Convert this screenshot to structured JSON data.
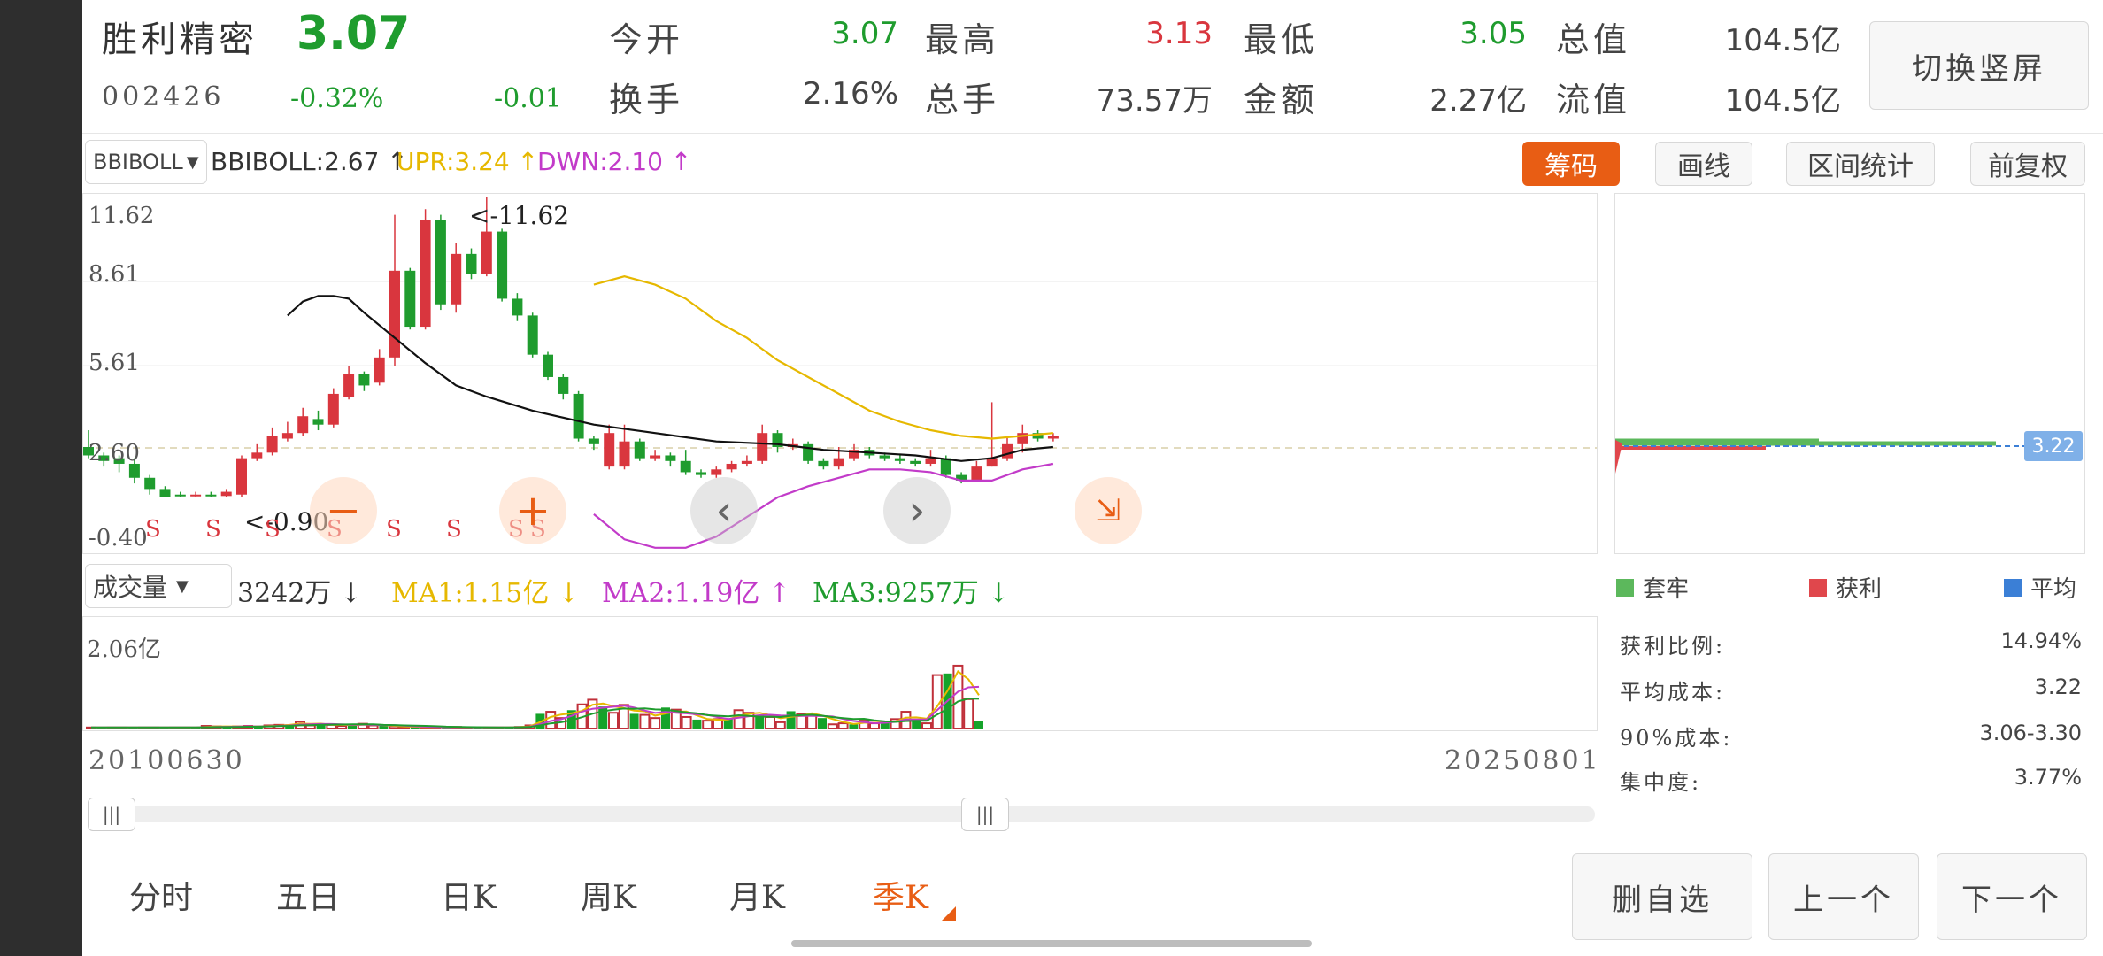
{
  "stock": {
    "name": "胜利精密",
    "price": "3.07",
    "code": "002426",
    "change_pct": "-0.32%",
    "change": "-0.01"
  },
  "quote": [
    {
      "label": "今开",
      "value": "3.07",
      "color": "#1f9c2e"
    },
    {
      "label": "最高",
      "value": "3.13",
      "color": "#d9363e"
    },
    {
      "label": "最低",
      "value": "3.05",
      "color": "#1f9c2e"
    },
    {
      "label": "总值",
      "value": "104.5亿",
      "color": "#444444"
    },
    {
      "label": "换手",
      "value": "2.16%",
      "color": "#444444"
    },
    {
      "label": "总手",
      "value": "73.57万",
      "color": "#444444"
    },
    {
      "label": "金额",
      "value": "2.27亿",
      "color": "#444444"
    },
    {
      "label": "流值",
      "value": "104.5亿",
      "color": "#444444"
    }
  ],
  "switch_button": "切换竖屏",
  "indicator": {
    "selector": "BBIBOLL",
    "bbiboll": "BBIBOLL:2.67 ↑",
    "upr": "UPR:3.24 ↑",
    "dwn": "DWN:2.10 ↑"
  },
  "tool_buttons": {
    "chips": "筹码",
    "draw": "画线",
    "range_stats": "区间统计",
    "adjust": "前复权"
  },
  "price_axis": [
    "11.62",
    "8.61",
    "5.61",
    "2.60",
    "-0.40"
  ],
  "annotations": {
    "high": "<-11.62",
    "low": "<-0.90",
    "signal": "S"
  },
  "volume": {
    "selector": "成交量",
    "vol": "3242万 ↓",
    "ma1": "MA1:1.15亿 ↓",
    "ma2": "MA2:1.19亿 ↑",
    "ma3": "MA3:9257万 ↓",
    "axis_max": "2.06亿"
  },
  "date_range": {
    "start": "20100630",
    "end": "20250801"
  },
  "chip_price_tag": "3.22",
  "chip_legend": [
    {
      "label": "套牢",
      "color": "#5cb85c"
    },
    {
      "label": "获利",
      "color": "#e0474c"
    },
    {
      "label": "平均",
      "color": "#3b7fd6"
    }
  ],
  "chip_stats": [
    {
      "label": "获利比例:",
      "value": "14.94%"
    },
    {
      "label": "平均成本:",
      "value": "3.22"
    },
    {
      "label": "90%成本:",
      "value": "3.06-3.30"
    },
    {
      "label": "集中度:",
      "value": "3.77%"
    }
  ],
  "period_tabs": [
    {
      "label": "分时",
      "active": false
    },
    {
      "label": "五日",
      "active": false
    },
    {
      "label": "日K",
      "active": false
    },
    {
      "label": "周K",
      "active": false
    },
    {
      "label": "月K",
      "active": false
    },
    {
      "label": "季K",
      "active": true
    }
  ],
  "nav_buttons": {
    "remove": "删自选",
    "prev": "上一个",
    "next": "下一个"
  },
  "chart_data": {
    "type": "candlestick",
    "period": "quarterly",
    "ylim": [
      -0.4,
      11.62
    ],
    "candles": [
      [
        2.7,
        2.4,
        3.3,
        2.3
      ],
      [
        2.4,
        2.2,
        2.5,
        2.0
      ],
      [
        2.3,
        2.1,
        2.4,
        1.8
      ],
      [
        2.1,
        1.6,
        2.3,
        1.4
      ],
      [
        1.6,
        1.2,
        1.7,
        1.0
      ],
      [
        1.2,
        0.9,
        1.3,
        0.9
      ],
      [
        1.0,
        0.95,
        1.1,
        0.9
      ],
      [
        0.95,
        1.0,
        1.1,
        0.9
      ],
      [
        1.0,
        0.95,
        1.1,
        0.9
      ],
      [
        0.95,
        1.1,
        1.2,
        0.9
      ],
      [
        1.0,
        2.3,
        2.4,
        0.9
      ],
      [
        2.3,
        2.5,
        2.8,
        2.2
      ],
      [
        2.5,
        3.1,
        3.4,
        2.4
      ],
      [
        3.0,
        3.2,
        3.6,
        2.9
      ],
      [
        3.2,
        3.8,
        4.1,
        3.1
      ],
      [
        3.7,
        3.5,
        4.0,
        3.3
      ],
      [
        3.5,
        4.6,
        4.8,
        3.4
      ],
      [
        4.5,
        5.3,
        5.6,
        4.4
      ],
      [
        5.3,
        4.9,
        5.4,
        4.7
      ],
      [
        5.0,
        5.9,
        6.2,
        4.9
      ],
      [
        5.9,
        9.0,
        11.0,
        5.6
      ],
      [
        9.0,
        7.0,
        9.1,
        6.9
      ],
      [
        7.0,
        10.8,
        11.2,
        6.9
      ],
      [
        10.8,
        7.8,
        11.0,
        7.6
      ],
      [
        7.8,
        9.6,
        10.0,
        7.5
      ],
      [
        9.6,
        8.9,
        9.8,
        8.7
      ],
      [
        8.9,
        10.4,
        11.62,
        8.8
      ],
      [
        10.4,
        8.0,
        10.5,
        7.9
      ],
      [
        8.0,
        7.4,
        8.2,
        7.2
      ],
      [
        7.4,
        6.0,
        7.5,
        5.9
      ],
      [
        6.0,
        5.2,
        6.1,
        5.1
      ],
      [
        5.2,
        4.6,
        5.3,
        4.4
      ],
      [
        4.6,
        3.0,
        4.7,
        2.9
      ],
      [
        3.0,
        2.8,
        3.1,
        2.6
      ],
      [
        2.0,
        3.2,
        3.5,
        1.9
      ],
      [
        2.0,
        2.9,
        3.5,
        1.9
      ],
      [
        2.9,
        2.3,
        3.0,
        2.2
      ],
      [
        2.3,
        2.4,
        2.6,
        2.2
      ],
      [
        2.4,
        2.2,
        2.5,
        2.0
      ],
      [
        2.2,
        1.8,
        2.6,
        1.7
      ],
      [
        1.8,
        1.7,
        1.9,
        1.6
      ],
      [
        1.7,
        1.9,
        2.0,
        1.6
      ],
      [
        1.9,
        2.1,
        2.2,
        1.8
      ],
      [
        2.1,
        2.2,
        2.4,
        2.0
      ],
      [
        2.2,
        3.2,
        3.5,
        2.1
      ],
      [
        3.2,
        2.7,
        3.3,
        2.5
      ],
      [
        2.7,
        2.8,
        3.0,
        2.6
      ],
      [
        2.8,
        2.2,
        2.9,
        2.1
      ],
      [
        2.2,
        2.0,
        2.3,
        1.9
      ],
      [
        2.0,
        2.3,
        2.7,
        1.9
      ],
      [
        2.3,
        2.6,
        2.8,
        2.2
      ],
      [
        2.6,
        2.4,
        2.7,
        2.3
      ],
      [
        2.4,
        2.3,
        2.5,
        2.2
      ],
      [
        2.3,
        2.2,
        2.4,
        2.1
      ],
      [
        2.2,
        2.1,
        2.3,
        2.0
      ],
      [
        2.1,
        2.3,
        2.6,
        2.0
      ],
      [
        2.3,
        1.7,
        2.4,
        1.6
      ],
      [
        1.7,
        1.5,
        1.8,
        1.4
      ],
      [
        1.5,
        2.0,
        2.2,
        1.5
      ],
      [
        2.0,
        2.3,
        4.3,
        2.0
      ],
      [
        2.3,
        2.8,
        3.1,
        2.2
      ],
      [
        2.8,
        3.2,
        3.5,
        2.5
      ],
      [
        3.2,
        3.0,
        3.3,
        2.9
      ],
      [
        3.0,
        3.1,
        3.2,
        2.9
      ]
    ],
    "bbiboll": [
      [
        13,
        7.4
      ],
      [
        14,
        7.9
      ],
      [
        15,
        8.1
      ],
      [
        16,
        8.1
      ],
      [
        17,
        8.0
      ],
      [
        18,
        7.5
      ],
      [
        20,
        6.6
      ],
      [
        22,
        5.7
      ],
      [
        24,
        4.9
      ],
      [
        26,
        4.5
      ],
      [
        29,
        4.0
      ],
      [
        33,
        3.5
      ],
      [
        37,
        3.2
      ],
      [
        41,
        2.9
      ],
      [
        45,
        2.8
      ],
      [
        48,
        2.6
      ],
      [
        51,
        2.5
      ],
      [
        54,
        2.4
      ],
      [
        57,
        2.2
      ],
      [
        59,
        2.3
      ],
      [
        61,
        2.6
      ],
      [
        63,
        2.7
      ]
    ],
    "upr": [
      [
        33,
        8.5
      ],
      [
        35,
        8.8
      ],
      [
        37,
        8.5
      ],
      [
        39,
        8.0
      ],
      [
        41,
        7.2
      ],
      [
        43,
        6.6
      ],
      [
        45,
        5.8
      ],
      [
        47,
        5.2
      ],
      [
        49,
        4.6
      ],
      [
        51,
        4.0
      ],
      [
        53,
        3.6
      ],
      [
        55,
        3.3
      ],
      [
        57,
        3.1
      ],
      [
        59,
        3.0
      ],
      [
        61,
        3.1
      ],
      [
        63,
        3.2
      ]
    ],
    "dwn": [
      [
        33,
        0.3
      ],
      [
        35,
        -0.6
      ],
      [
        37,
        -0.9
      ],
      [
        39,
        -0.9
      ],
      [
        41,
        -0.5
      ],
      [
        43,
        0.2
      ],
      [
        45,
        0.9
      ],
      [
        47,
        1.3
      ],
      [
        49,
        1.6
      ],
      [
        51,
        1.9
      ],
      [
        53,
        1.9
      ],
      [
        55,
        1.8
      ],
      [
        57,
        1.5
      ],
      [
        59,
        1.5
      ],
      [
        61,
        1.9
      ],
      [
        63,
        2.1
      ]
    ],
    "volume": [
      0.02,
      0.02,
      0.02,
      0.02,
      0.02,
      0.02,
      0.02,
      0.02,
      0.02,
      0.02,
      0.02,
      0.05,
      0.04,
      0.03,
      0.04,
      0.05,
      0.03,
      0.06,
      0.07,
      0.08,
      0.13,
      0.06,
      0.09,
      0.07,
      0.05,
      0.08,
      0.09,
      0.06,
      0.05,
      0.04,
      0.03,
      0.03,
      0.03,
      0.02,
      0.02,
      0.03,
      0.02,
      0.02,
      0.02,
      0.02,
      0.03,
      0.03,
      0.06,
      0.28,
      0.32,
      0.2,
      0.35,
      0.46,
      0.55,
      0.42,
      0.3,
      0.45,
      0.28,
      0.26,
      0.2,
      0.4,
      0.36,
      0.22,
      0.17,
      0.15,
      0.18,
      0.19,
      0.35,
      0.3,
      0.25,
      0.22,
      0.12,
      0.33,
      0.28,
      0.26,
      0.2,
      0.08,
      0.1,
      0.08,
      0.15,
      0.1,
      0.12,
      0.18,
      0.32,
      0.14,
      0.1,
      1.02,
      1.05,
      1.2,
      0.56,
      0.15
    ],
    "vol_ylim": [
      0,
      2.06
    ]
  }
}
